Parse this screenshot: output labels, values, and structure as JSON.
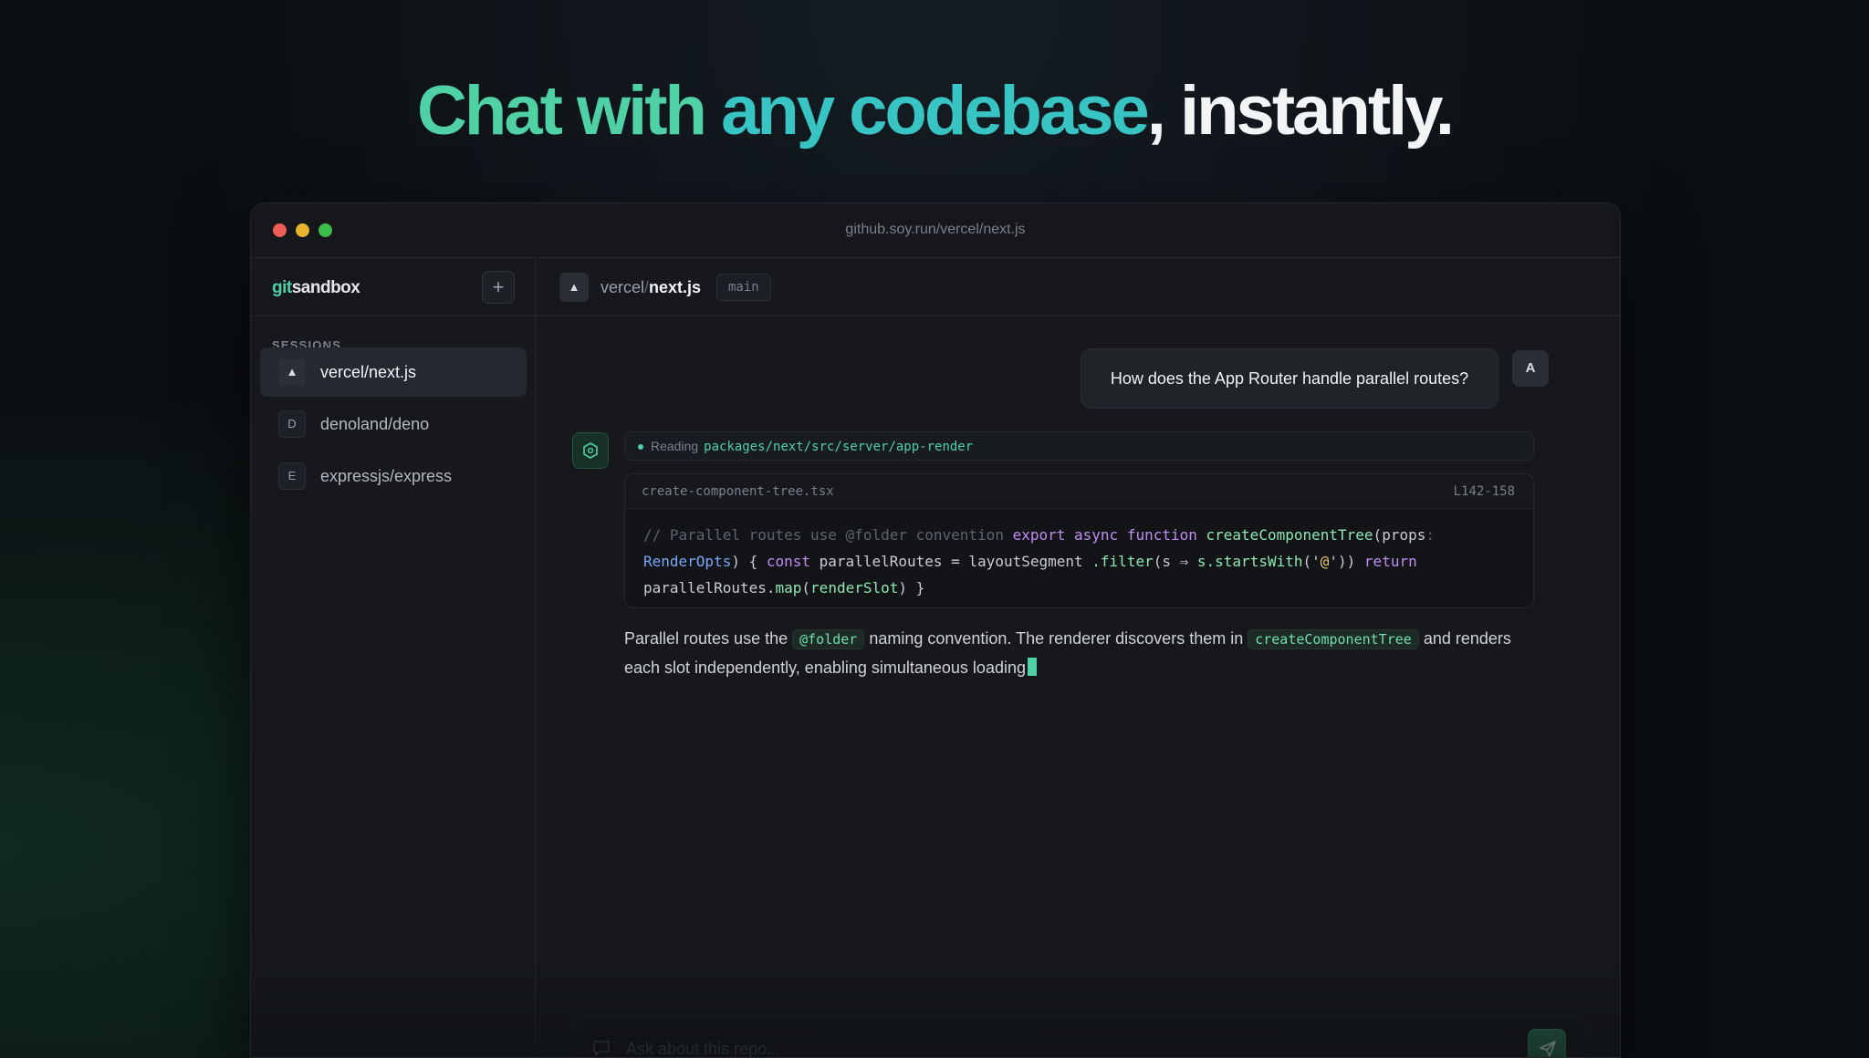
{
  "hero": {
    "part1": "Chat with ",
    "part2": "any codebase",
    "part3": ", instantly."
  },
  "window": {
    "url": "github.soy.run/vercel/next.js"
  },
  "sidebar": {
    "logo_git": "git",
    "logo_rest": "sandbox",
    "new_button": "+",
    "sessions_label": "SESSIONS",
    "sessions": [
      {
        "badge": "▲",
        "name": "vercel/next.js",
        "active": true
      },
      {
        "badge": "D",
        "name": "denoland/deno",
        "active": false
      },
      {
        "badge": "E",
        "name": "expressjs/express",
        "active": false
      }
    ]
  },
  "header": {
    "repo_icon": "▲",
    "owner": "vercel",
    "separator": "/",
    "repo": "next.js",
    "branch": "main"
  },
  "chat": {
    "user_message": "How does the App Router handle parallel routes?",
    "user_avatar": "A",
    "bot_icon": "hexagon-icon",
    "reading_label": "Reading",
    "reading_path": "packages/next/src/server/app-render",
    "code": {
      "filename": "create-component-tree.tsx",
      "lines": "L142-158",
      "tokens": [
        {
          "t": "// Parallel routes use @folder convention ",
          "c": "c-com"
        },
        {
          "t": "export ",
          "c": "c-kw"
        },
        {
          "t": "async ",
          "c": "c-kw"
        },
        {
          "t": "function ",
          "c": "c-kw"
        },
        {
          "t": "createComponentTree",
          "c": "c-fn"
        },
        {
          "t": "(",
          "c": "c-plain"
        },
        {
          "t": "props",
          "c": "c-plain"
        },
        {
          "t": ": ",
          "c": "c-com"
        },
        {
          "t": "RenderOpts",
          "c": "c-ty"
        },
        {
          "t": ") { ",
          "c": "c-plain"
        },
        {
          "t": "const ",
          "c": "c-kw"
        },
        {
          "t": "parallelRoutes = layoutSegment ",
          "c": "c-plain"
        },
        {
          "t": ".filter",
          "c": "c-fn"
        },
        {
          "t": "(s ⇒ ",
          "c": "c-plain"
        },
        {
          "t": "s.startsWith",
          "c": "c-fn"
        },
        {
          "t": "('",
          "c": "c-plain"
        },
        {
          "t": "@",
          "c": "c-str"
        },
        {
          "t": "')) ",
          "c": "c-plain"
        },
        {
          "t": "return ",
          "c": "c-kw"
        },
        {
          "t": "parallelRoutes.",
          "c": "c-plain"
        },
        {
          "t": "map",
          "c": "c-fn"
        },
        {
          "t": "(",
          "c": "c-plain"
        },
        {
          "t": "renderSlot",
          "c": "c-fn"
        },
        {
          "t": ") }",
          "c": "c-plain"
        }
      ]
    },
    "answer": {
      "t1": "Parallel routes use the ",
      "code1": "@folder",
      "t2": " naming convention. The renderer discovers them in ",
      "code2": "createComponentTree",
      "t3": " and renders each slot independently, enabling simultaneous loading"
    }
  },
  "composer": {
    "placeholder": "Ask about this repo...",
    "send_icon": "send-icon"
  }
}
